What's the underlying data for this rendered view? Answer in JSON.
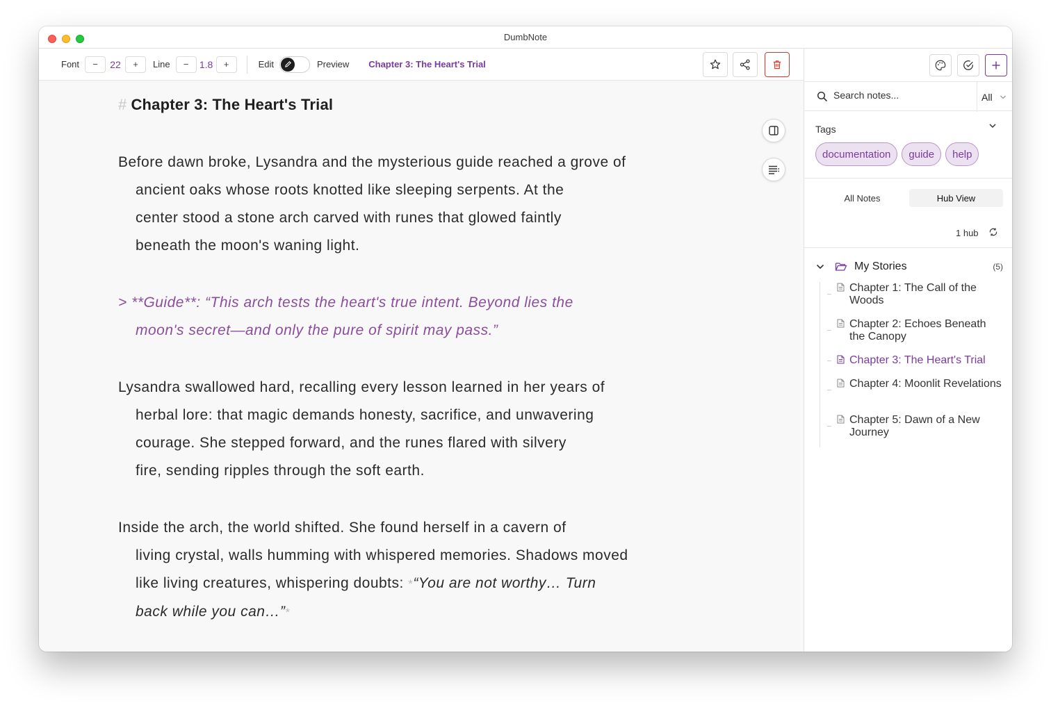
{
  "window": {
    "title": "DumbNote"
  },
  "toolbar": {
    "font_label": "Font",
    "font_value": "22",
    "line_label": "Line",
    "line_value": "1.8",
    "minus": "−",
    "plus": "+",
    "edit_label": "Edit",
    "preview_label": "Preview",
    "note_title": "Chapter 3: The Heart's Trial"
  },
  "editor": {
    "heading_mark": "#",
    "heading": "Chapter 3: The Heart's Trial",
    "p1": [
      "Before dawn broke, Lysandra and the mysterious guide reached a grove of",
      "ancient oaks whose roots knotted like sleeping serpents. At the",
      "center stood a stone arch carved with runes that glowed faintly",
      "beneath the moon's waning light."
    ],
    "quote": [
      "> **Guide**: “This arch tests the heart's true intent. Beyond lies the",
      "moon's secret—and only the pure of spirit may pass.”"
    ],
    "p2": [
      "Lysandra swallowed hard, recalling every lesson learned in her years of",
      "herbal lore: that magic demands honesty, sacrifice, and unwavering",
      "courage. She stepped forward, and the runes flared with silvery",
      "fire, sending ripples through the soft earth."
    ],
    "p3": {
      "line1": "Inside the arch, the world shifted. She found herself in a cavern of",
      "line2": "living crystal, walls humming with whispered memories. Shadows moved",
      "line3_plain": "like living creatures, whispering doubts: ",
      "line3_em": "“You are not worthy… Turn",
      "line4_em": "back while you can…”",
      "em_mark": "*"
    }
  },
  "sidebar": {
    "search_placeholder": "Search notes...",
    "filter_value": "All",
    "tags_label": "Tags",
    "tags": [
      "documentation",
      "guide",
      "help"
    ],
    "tabs": [
      "All Notes",
      "Hub View"
    ],
    "active_tab": "Hub View",
    "hub_count": "1 hub",
    "folder": {
      "name": "My Stories",
      "count": "(5)"
    },
    "notes": [
      {
        "title": "Chapter 1: The Call of the Woods",
        "active": false
      },
      {
        "title": "Chapter 2: Echoes Beneath the Canopy",
        "active": false
      },
      {
        "title": "Chapter 3: The Heart's Trial",
        "active": true
      },
      {
        "title": "Chapter 4: Moonlit Revelations",
        "active": false
      },
      {
        "title": "Chapter 5: Dawn of a New Journey",
        "active": false
      }
    ]
  },
  "colors": {
    "accent": "#7b3aa0",
    "quote": "#8a4e9c",
    "delete": "#d33a2c",
    "tag_bg": "#ece1f1"
  },
  "icons": [
    "star-icon",
    "share-icon",
    "trash-icon",
    "split-view-icon",
    "outline-icon",
    "palette-icon",
    "check-circle-icon",
    "plus-icon",
    "search-icon",
    "chevron-down-icon",
    "refresh-icon",
    "folder-icon",
    "document-icon",
    "pencil-icon"
  ]
}
